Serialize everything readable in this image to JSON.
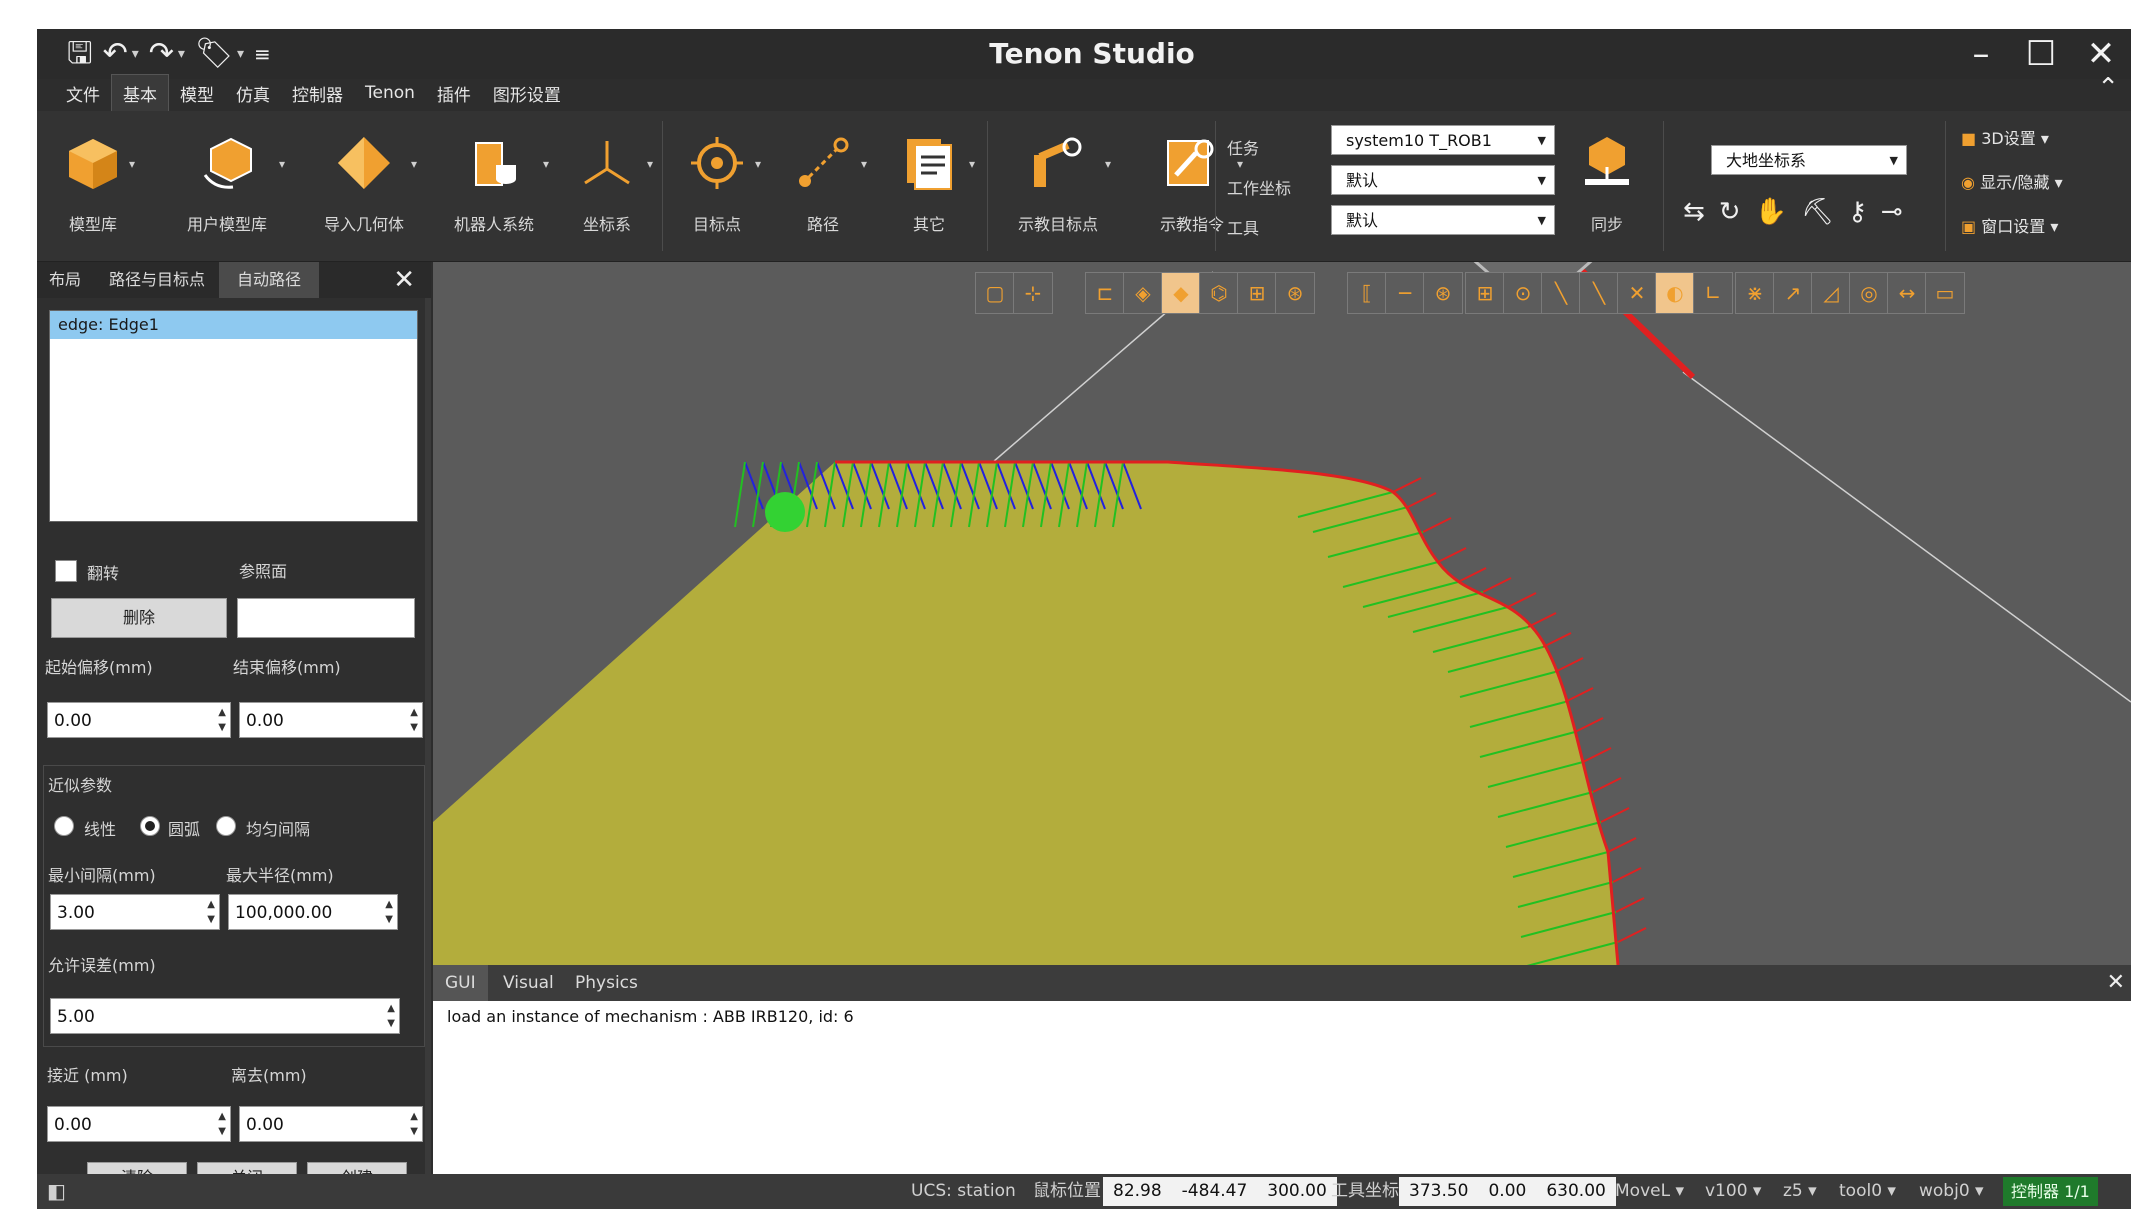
{
  "app": {
    "title": "Tenon Studio"
  },
  "menu": {
    "tabs": [
      "文件",
      "基本",
      "模型",
      "仿真",
      "控制器",
      "Tenon",
      "插件",
      "图形设置"
    ],
    "active": "基本"
  },
  "ribbon": {
    "buttons": {
      "model_lib": "模型库",
      "user_model_lib": "用户模型库",
      "import_geometry": "导入几何体",
      "robot_system": "机器人系统",
      "coord_system": "坐标系",
      "target": "目标点",
      "path": "路径",
      "other": "其它",
      "teach_target": "示教目标点",
      "teach_instruction": "示教指令",
      "sync": "同步"
    },
    "fields": {
      "task_label": "任务",
      "task_value": "system10 T_ROB1",
      "wobj_label": "工作坐标",
      "wobj_value": "默认",
      "tool_label": "工具",
      "tool_value": "默认"
    },
    "frame_select": "大地坐标系",
    "right_tools": {
      "settings_3d": "3D设置",
      "show_hide": "显示/隐藏",
      "window_settings": "窗口设置"
    }
  },
  "left_panel": {
    "tabs": [
      "布局",
      "路径与目标点",
      "自动路径"
    ],
    "active_tab": "自动路径",
    "edge_list": [
      "edge: Edge1"
    ],
    "flip_label": "翻转",
    "ref_surface_label": "参照面",
    "delete_button": "删除",
    "start_offset_label": "起始偏移(mm)",
    "end_offset_label": "结束偏移(mm)",
    "start_offset": "0.00",
    "end_offset": "0.00",
    "approx_group_title": "近似参数",
    "radio_options": [
      "线性",
      "圆弧",
      "均匀间隔"
    ],
    "radio_selected": "圆弧",
    "min_gap_label": "最小间隔(mm)",
    "max_radius_label": "最大半径(mm)",
    "min_gap": "3.00",
    "max_radius": "100,000.00",
    "tolerance_label": "允许误差(mm)",
    "tolerance": "5.00",
    "approach_label": "接近 (mm)",
    "depart_label": "离去(mm)",
    "approach": "0.00",
    "depart": "0.00",
    "bottom_buttons": [
      "清除",
      "关闭",
      "创建"
    ]
  },
  "log": {
    "tabs": [
      "GUI",
      "Visual",
      "Physics"
    ],
    "active_tab": "GUI",
    "lines": [
      "load an instance of mechanism : ABB IRB120, id: 6"
    ]
  },
  "status": {
    "ucs": "UCS: station",
    "mouse_pos_label": "鼠标位置",
    "mouse_pos": [
      "82.98",
      "-484.47",
      "300.00"
    ],
    "tool_coord_label": "工具坐标",
    "tool_coord": [
      "373.50",
      "0.00",
      "630.00"
    ],
    "motion": "MoveL",
    "speed": "v100",
    "zone": "z5",
    "tool": "tool0",
    "wobj": "wobj0",
    "controller": "控制器 1/1"
  },
  "colors": {
    "accent_orange": "#f0a030",
    "path_red": "#e02020",
    "path_green": "#22c022",
    "path_blue": "#2222dd",
    "surface": "#b3ad3c"
  }
}
